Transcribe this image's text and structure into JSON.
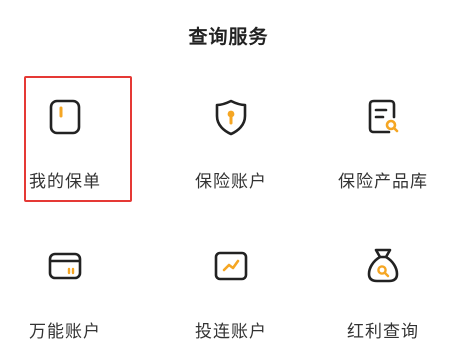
{
  "section": {
    "title": "查询服务"
  },
  "services": [
    {
      "label": "我的保单",
      "icon": "policy-card-icon",
      "selected": true
    },
    {
      "label": "保险账户",
      "icon": "shield-key-icon",
      "selected": false
    },
    {
      "label": "保险产品库",
      "icon": "document-search-icon",
      "selected": false
    },
    {
      "label": "万能账户",
      "icon": "wallet-icon",
      "selected": false
    },
    {
      "label": "投连账户",
      "icon": "trend-chart-icon",
      "selected": false
    },
    {
      "label": "红利查询",
      "icon": "money-bag-icon",
      "selected": false
    }
  ],
  "colors": {
    "icon_stroke": "#222222",
    "accent": "#f5a623",
    "selection_border": "#e53935",
    "text": "#333333"
  }
}
